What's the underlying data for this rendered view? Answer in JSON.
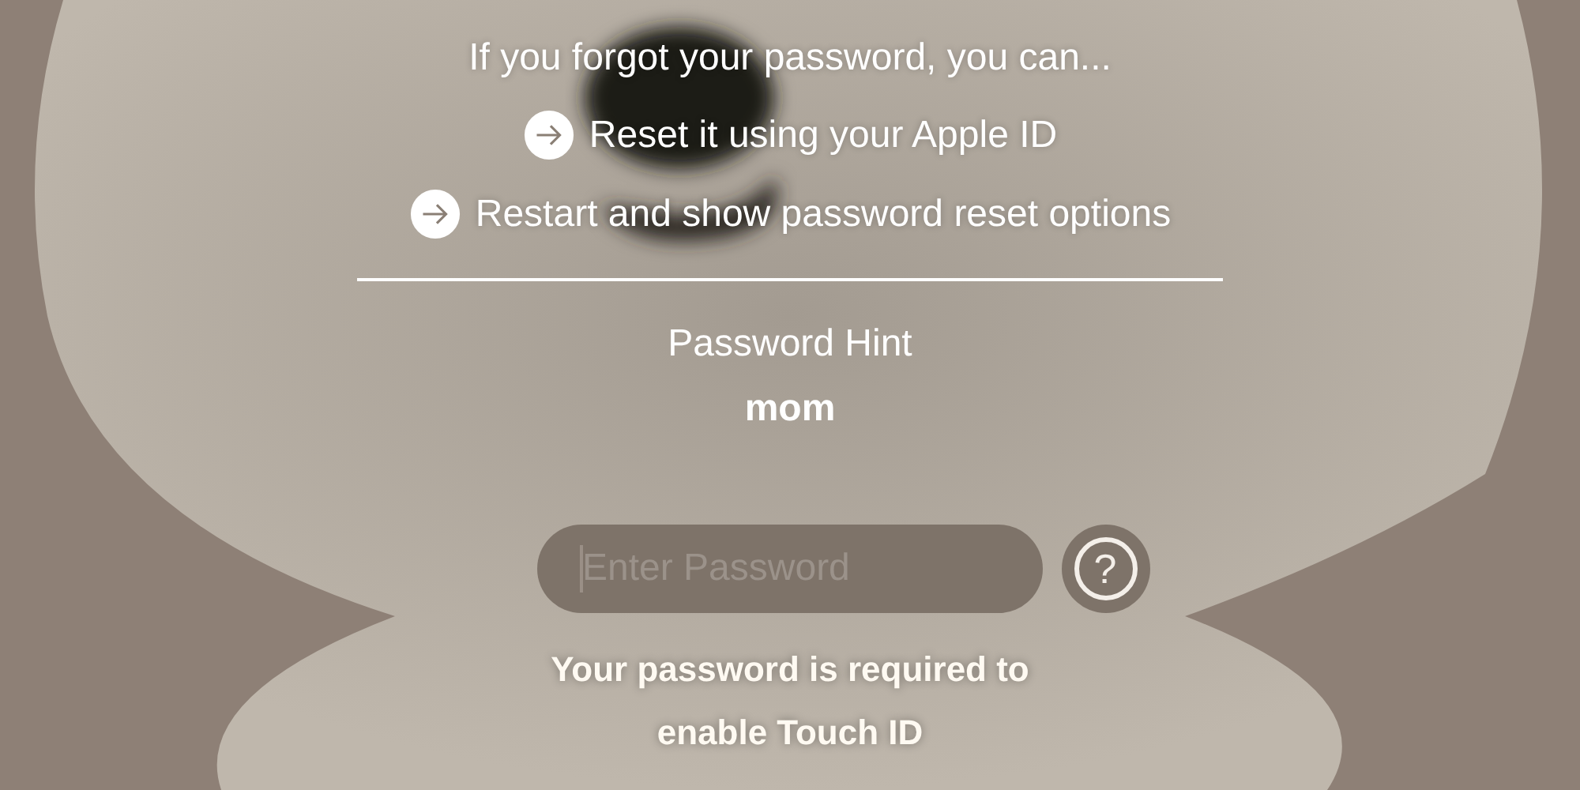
{
  "recovery": {
    "title": "If you forgot your password, you can...",
    "options": [
      {
        "label": "Reset it using your Apple ID"
      },
      {
        "label": "Restart and show password reset options"
      }
    ]
  },
  "hint": {
    "label": "Password Hint",
    "value": "mom"
  },
  "password_field": {
    "placeholder": "Enter Password"
  },
  "help_button": {
    "label": "?"
  },
  "message": "Your password is required to enable Touch ID"
}
